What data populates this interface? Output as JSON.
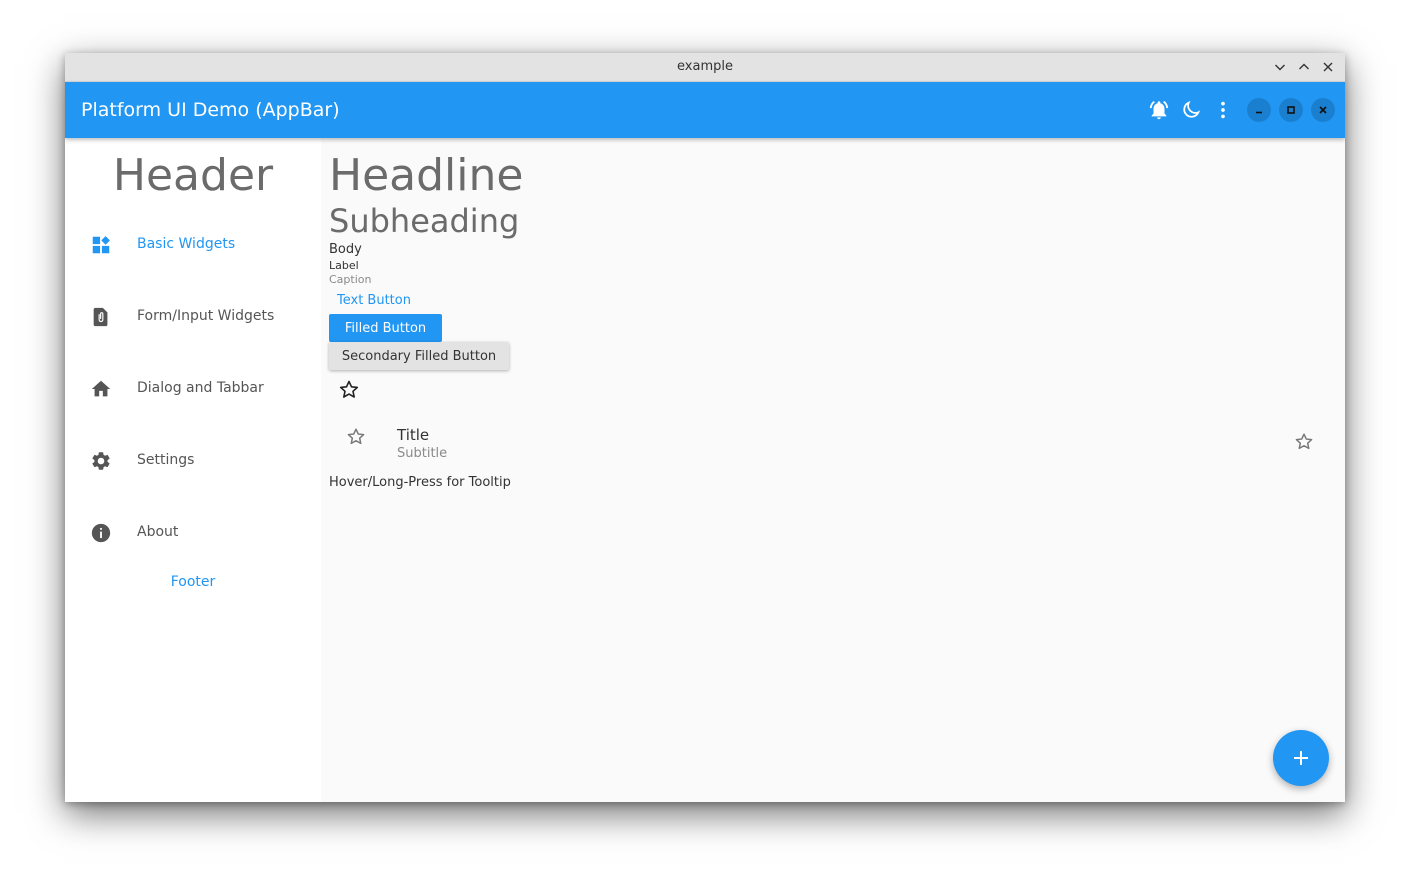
{
  "window": {
    "title": "example"
  },
  "appbar": {
    "title": "Platform UI Demo (AppBar)",
    "icons": [
      "bell-ring-icon",
      "moon-icon",
      "more-vert-icon",
      "minimize-icon",
      "maximize-icon",
      "close-icon"
    ]
  },
  "sidebar": {
    "header": "Header",
    "items": [
      {
        "label": "Basic Widgets",
        "icon": "dashboard-icon",
        "active": true
      },
      {
        "label": "Form/Input Widgets",
        "icon": "file-clip-icon",
        "active": false
      },
      {
        "label": "Dialog and Tabbar",
        "icon": "home-icon",
        "active": false
      },
      {
        "label": "Settings",
        "icon": "gear-icon",
        "active": false
      },
      {
        "label": "About",
        "icon": "info-icon",
        "active": false
      }
    ],
    "footer": "Footer"
  },
  "content": {
    "headline": "Headline",
    "subheading": "Subheading",
    "body": "Body",
    "label": "Label",
    "caption": "Caption",
    "text_button": "Text Button",
    "filled_button": "Filled Button",
    "secondary_button": "Secondary Filled Button",
    "list_tile": {
      "title": "Title",
      "subtitle": "Subtitle"
    },
    "tooltip_text": "Hover/Long-Press for Tooltip"
  },
  "colors": {
    "primary": "#2196f3",
    "appbar_text": "#ffffff",
    "background": "#fafafa",
    "sidebar_bg": "#ffffff"
  }
}
